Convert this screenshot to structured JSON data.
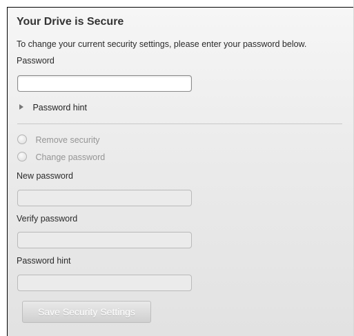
{
  "title": "Your Drive is Secure",
  "instruction": "To change your current security settings, please enter your password below.",
  "password": {
    "label": "Password",
    "value": ""
  },
  "hint_toggle": {
    "label": "Password hint"
  },
  "options": [
    {
      "label": "Remove security",
      "selected": false,
      "enabled": false
    },
    {
      "label": "Change password",
      "selected": false,
      "enabled": false
    }
  ],
  "new_password": {
    "label": "New password",
    "value": ""
  },
  "verify_password": {
    "label": "Verify password",
    "value": ""
  },
  "password_hint_field": {
    "label": "Password hint",
    "value": ""
  },
  "save_button": {
    "label": "Save Security Settings",
    "enabled": false
  }
}
